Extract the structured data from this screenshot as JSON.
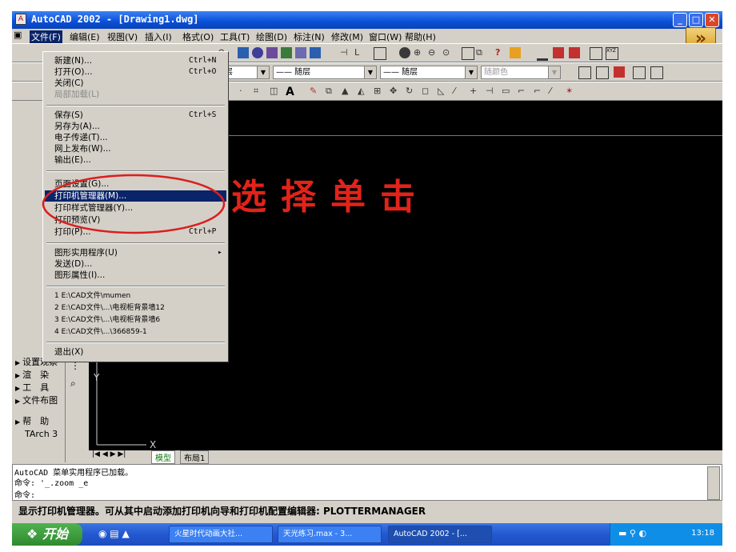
{
  "window": {
    "title": "AutoCAD 2002 - [Drawing1.dwg]",
    "buttons": {
      "minimize": "_",
      "maximize": "□",
      "close": "✕"
    }
  },
  "menubar": {
    "items": [
      "文件(F)",
      "编辑(E)",
      "视图(V)",
      "插入(I)",
      "格式(O)",
      "工具(T)",
      "绘图(D)",
      "标注(N)",
      "修改(M)",
      "窗口(W)",
      "帮助(H)"
    ]
  },
  "toolbar": {
    "layer_combo": "随层",
    "linetype_combo": "—— 随层",
    "lineweight_combo": "—— 随层",
    "color_combo": "随颜色",
    "text_tool": "A"
  },
  "file_menu": {
    "items": [
      {
        "label": "新建(N)...",
        "shortcut": "Ctrl+N"
      },
      {
        "label": "打开(O)...",
        "shortcut": "Ctrl+O"
      },
      {
        "label": "关闭(C)",
        "shortcut": ""
      },
      {
        "label": "局部加载(L)",
        "shortcut": ""
      },
      {
        "label": "保存(S)",
        "shortcut": "Ctrl+S"
      },
      {
        "label": "另存为(A)...",
        "shortcut": ""
      },
      {
        "label": "电子传递(T)...",
        "shortcut": ""
      },
      {
        "label": "网上发布(W)...",
        "shortcut": ""
      },
      {
        "label": "输出(E)...",
        "shortcut": ""
      },
      {
        "label": "页面设置(G)...",
        "shortcut": ""
      },
      {
        "label": "打印机管理器(M)...",
        "shortcut": ""
      },
      {
        "label": "打印样式管理器(Y)...",
        "shortcut": ""
      },
      {
        "label": "打印预览(V)",
        "shortcut": ""
      },
      {
        "label": "打印(P)...",
        "shortcut": "Ctrl+P"
      },
      {
        "label": "图形实用程序(U)",
        "shortcut": "▸"
      },
      {
        "label": "发送(D)...",
        "shortcut": ""
      },
      {
        "label": "图形属性(I)...",
        "shortcut": ""
      },
      {
        "label": "1 E:\\CAD文件\\mumen",
        "shortcut": ""
      },
      {
        "label": "2 E:\\CAD文件\\...\\电视柜背景墙12",
        "shortcut": ""
      },
      {
        "label": "3 E:\\CAD文件\\...\\电视柜背景墙6",
        "shortcut": ""
      },
      {
        "label": "4 E:\\CAD文件\\...\\366859-1",
        "shortcut": ""
      },
      {
        "label": "退出(X)",
        "shortcut": ""
      }
    ]
  },
  "annotation": {
    "text": "选择单击"
  },
  "left_panel": {
    "items": [
      "设置观察",
      "渲　染",
      "工　具",
      "文件布图",
      "帮　助",
      "TArch 3"
    ]
  },
  "tabs": {
    "model": "模型",
    "layout1": "布局1"
  },
  "command": {
    "line1": "AutoCAD 菜单实用程序已加载。",
    "line2": "命令: '_.zoom _e",
    "line3": "命令:"
  },
  "status_message": "显示打印机管理器。可从其中启动添加打印机向导和打印机配置编辑器: PLOTTERMANAGER",
  "taskbar": {
    "start": "开始",
    "tasks": [
      "火星时代动画大社...",
      "天光练习.max - 3...",
      "AutoCAD 2002 - [..."
    ],
    "clock": "13:18"
  },
  "colors": {
    "highlight": "#0a246a",
    "annotation_red": "#e2231a",
    "canvas": "#000000",
    "xp_title": "#0a4fd8"
  }
}
